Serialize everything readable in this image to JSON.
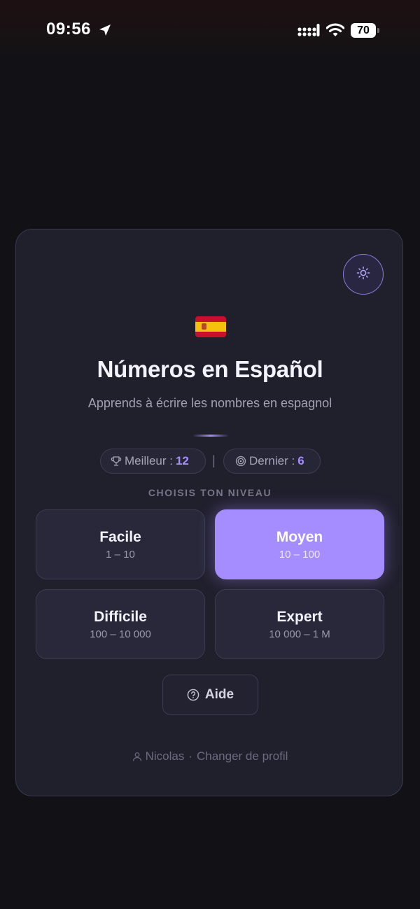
{
  "status_bar": {
    "time": "09:56",
    "battery": "70"
  },
  "app": {
    "title": "Números en Español",
    "subtitle": "Apprends à écrire les nombres en espagnol",
    "accent_color": "#a58cff",
    "flag_icon": "spain-flag-icon",
    "theme_icon": "sun-icon"
  },
  "stats": {
    "best_label": "Meilleur :",
    "best_value": "12",
    "separator": "|",
    "last_label": "Dernier :",
    "last_value": "6"
  },
  "levels": {
    "heading": "CHOISIS TON NIVEAU",
    "items": [
      {
        "name": "Facile",
        "range": "1 – 10",
        "selected": false
      },
      {
        "name": "Moyen",
        "range": "10 – 100",
        "selected": true
      },
      {
        "name": "Difficile",
        "range": "100 – 10 000",
        "selected": false
      },
      {
        "name": "Expert",
        "range": "10 000 – 1 M",
        "selected": false
      }
    ]
  },
  "help": {
    "label": "Aide"
  },
  "profile": {
    "name": "Nicolas",
    "separator": "·",
    "change_label": "Changer de profil"
  }
}
